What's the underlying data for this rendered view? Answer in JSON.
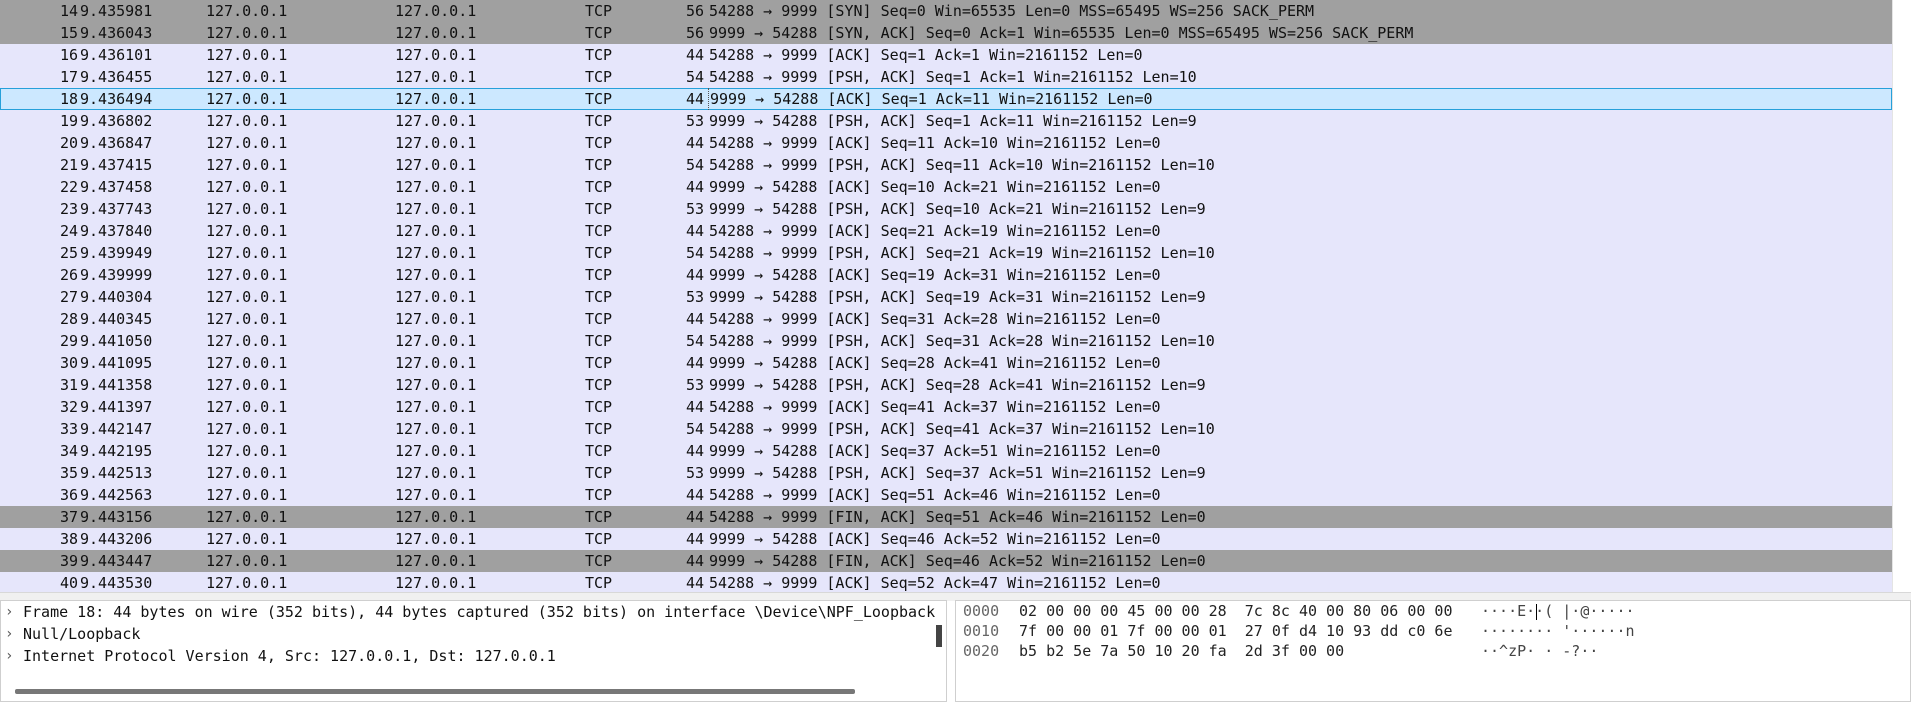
{
  "packets": [
    {
      "no": "14",
      "time": "9.435981",
      "src": "127.0.0.1",
      "dst": "127.0.0.1",
      "proto": "TCP",
      "len": "56",
      "info": "54288 → 9999 [SYN] Seq=0 Win=65535 Len=0 MSS=65495 WS=256 SACK_PERM",
      "style": "flag"
    },
    {
      "no": "15",
      "time": "9.436043",
      "src": "127.0.0.1",
      "dst": "127.0.0.1",
      "proto": "TCP",
      "len": "56",
      "info": "9999 → 54288 [SYN, ACK] Seq=0 Ack=1 Win=65535 Len=0 MSS=65495 WS=256 SACK_PERM",
      "style": "flag"
    },
    {
      "no": "16",
      "time": "9.436101",
      "src": "127.0.0.1",
      "dst": "127.0.0.1",
      "proto": "TCP",
      "len": "44",
      "info": "54288 → 9999 [ACK] Seq=1 Ack=1 Win=2161152 Len=0",
      "style": ""
    },
    {
      "no": "17",
      "time": "9.436455",
      "src": "127.0.0.1",
      "dst": "127.0.0.1",
      "proto": "TCP",
      "len": "54",
      "info": "54288 → 9999 [PSH, ACK] Seq=1 Ack=1 Win=2161152 Len=10",
      "style": ""
    },
    {
      "no": "18",
      "time": "9.436494",
      "src": "127.0.0.1",
      "dst": "127.0.0.1",
      "proto": "TCP",
      "len": "44",
      "info": "9999 → 54288 [ACK] Seq=1 Ack=11 Win=2161152 Len=0",
      "style": "sel"
    },
    {
      "no": "19",
      "time": "9.436802",
      "src": "127.0.0.1",
      "dst": "127.0.0.1",
      "proto": "TCP",
      "len": "53",
      "info": "9999 → 54288 [PSH, ACK] Seq=1 Ack=11 Win=2161152 Len=9",
      "style": ""
    },
    {
      "no": "20",
      "time": "9.436847",
      "src": "127.0.0.1",
      "dst": "127.0.0.1",
      "proto": "TCP",
      "len": "44",
      "info": "54288 → 9999 [ACK] Seq=11 Ack=10 Win=2161152 Len=0",
      "style": ""
    },
    {
      "no": "21",
      "time": "9.437415",
      "src": "127.0.0.1",
      "dst": "127.0.0.1",
      "proto": "TCP",
      "len": "54",
      "info": "54288 → 9999 [PSH, ACK] Seq=11 Ack=10 Win=2161152 Len=10",
      "style": ""
    },
    {
      "no": "22",
      "time": "9.437458",
      "src": "127.0.0.1",
      "dst": "127.0.0.1",
      "proto": "TCP",
      "len": "44",
      "info": "9999 → 54288 [ACK] Seq=10 Ack=21 Win=2161152 Len=0",
      "style": ""
    },
    {
      "no": "23",
      "time": "9.437743",
      "src": "127.0.0.1",
      "dst": "127.0.0.1",
      "proto": "TCP",
      "len": "53",
      "info": "9999 → 54288 [PSH, ACK] Seq=10 Ack=21 Win=2161152 Len=9",
      "style": ""
    },
    {
      "no": "24",
      "time": "9.437840",
      "src": "127.0.0.1",
      "dst": "127.0.0.1",
      "proto": "TCP",
      "len": "44",
      "info": "54288 → 9999 [ACK] Seq=21 Ack=19 Win=2161152 Len=0",
      "style": ""
    },
    {
      "no": "25",
      "time": "9.439949",
      "src": "127.0.0.1",
      "dst": "127.0.0.1",
      "proto": "TCP",
      "len": "54",
      "info": "54288 → 9999 [PSH, ACK] Seq=21 Ack=19 Win=2161152 Len=10",
      "style": ""
    },
    {
      "no": "26",
      "time": "9.439999",
      "src": "127.0.0.1",
      "dst": "127.0.0.1",
      "proto": "TCP",
      "len": "44",
      "info": "9999 → 54288 [ACK] Seq=19 Ack=31 Win=2161152 Len=0",
      "style": ""
    },
    {
      "no": "27",
      "time": "9.440304",
      "src": "127.0.0.1",
      "dst": "127.0.0.1",
      "proto": "TCP",
      "len": "53",
      "info": "9999 → 54288 [PSH, ACK] Seq=19 Ack=31 Win=2161152 Len=9",
      "style": ""
    },
    {
      "no": "28",
      "time": "9.440345",
      "src": "127.0.0.1",
      "dst": "127.0.0.1",
      "proto": "TCP",
      "len": "44",
      "info": "54288 → 9999 [ACK] Seq=31 Ack=28 Win=2161152 Len=0",
      "style": ""
    },
    {
      "no": "29",
      "time": "9.441050",
      "src": "127.0.0.1",
      "dst": "127.0.0.1",
      "proto": "TCP",
      "len": "54",
      "info": "54288 → 9999 [PSH, ACK] Seq=31 Ack=28 Win=2161152 Len=10",
      "style": ""
    },
    {
      "no": "30",
      "time": "9.441095",
      "src": "127.0.0.1",
      "dst": "127.0.0.1",
      "proto": "TCP",
      "len": "44",
      "info": "9999 → 54288 [ACK] Seq=28 Ack=41 Win=2161152 Len=0",
      "style": ""
    },
    {
      "no": "31",
      "time": "9.441358",
      "src": "127.0.0.1",
      "dst": "127.0.0.1",
      "proto": "TCP",
      "len": "53",
      "info": "9999 → 54288 [PSH, ACK] Seq=28 Ack=41 Win=2161152 Len=9",
      "style": ""
    },
    {
      "no": "32",
      "time": "9.441397",
      "src": "127.0.0.1",
      "dst": "127.0.0.1",
      "proto": "TCP",
      "len": "44",
      "info": "54288 → 9999 [ACK] Seq=41 Ack=37 Win=2161152 Len=0",
      "style": ""
    },
    {
      "no": "33",
      "time": "9.442147",
      "src": "127.0.0.1",
      "dst": "127.0.0.1",
      "proto": "TCP",
      "len": "54",
      "info": "54288 → 9999 [PSH, ACK] Seq=41 Ack=37 Win=2161152 Len=10",
      "style": ""
    },
    {
      "no": "34",
      "time": "9.442195",
      "src": "127.0.0.1",
      "dst": "127.0.0.1",
      "proto": "TCP",
      "len": "44",
      "info": "9999 → 54288 [ACK] Seq=37 Ack=51 Win=2161152 Len=0",
      "style": ""
    },
    {
      "no": "35",
      "time": "9.442513",
      "src": "127.0.0.1",
      "dst": "127.0.0.1",
      "proto": "TCP",
      "len": "53",
      "info": "9999 → 54288 [PSH, ACK] Seq=37 Ack=51 Win=2161152 Len=9",
      "style": ""
    },
    {
      "no": "36",
      "time": "9.442563",
      "src": "127.0.0.1",
      "dst": "127.0.0.1",
      "proto": "TCP",
      "len": "44",
      "info": "54288 → 9999 [ACK] Seq=51 Ack=46 Win=2161152 Len=0",
      "style": ""
    },
    {
      "no": "37",
      "time": "9.443156",
      "src": "127.0.0.1",
      "dst": "127.0.0.1",
      "proto": "TCP",
      "len": "44",
      "info": "54288 → 9999 [FIN, ACK] Seq=51 Ack=46 Win=2161152 Len=0",
      "style": "flag"
    },
    {
      "no": "38",
      "time": "9.443206",
      "src": "127.0.0.1",
      "dst": "127.0.0.1",
      "proto": "TCP",
      "len": "44",
      "info": "9999 → 54288 [ACK] Seq=46 Ack=52 Win=2161152 Len=0",
      "style": ""
    },
    {
      "no": "39",
      "time": "9.443447",
      "src": "127.0.0.1",
      "dst": "127.0.0.1",
      "proto": "TCP",
      "len": "44",
      "info": "9999 → 54288 [FIN, ACK] Seq=46 Ack=52 Win=2161152 Len=0",
      "style": "flag"
    },
    {
      "no": "40",
      "time": "9.443530",
      "src": "127.0.0.1",
      "dst": "127.0.0.1",
      "proto": "TCP",
      "len": "44",
      "info": "54288 → 9999 [ACK] Seq=52 Ack=47 Win=2161152 Len=0",
      "style": ""
    }
  ],
  "details": [
    {
      "arrow": "›",
      "text": "Frame 18: 44 bytes on wire (352 bits), 44 bytes captured (352 bits) on interface \\Device\\NPF_Loopback"
    },
    {
      "arrow": "›",
      "text": "Null/Loopback"
    },
    {
      "arrow": "›",
      "text": "Internet Protocol Version 4, Src: 127.0.0.1, Dst: 127.0.0.1"
    }
  ],
  "bytes": [
    {
      "offset": "0000",
      "hex": "02 00 00 00 45 00 00 28  7c 8c 40 00 80 06 00 00",
      "ascii": "····E··( |·@·····"
    },
    {
      "offset": "0010",
      "hex": "7f 00 00 01 7f 00 00 01  27 0f d4 10 93 dd c0 6e",
      "ascii": "········ '······n"
    },
    {
      "offset": "0020",
      "hex": "b5 b2 5e 7a 50 10 20 fa  2d 3f 00 00",
      "ascii": "··^zP· · -?··"
    }
  ],
  "colors": {
    "row_bg": "#e6e6fb",
    "flag_row_bg": "#a0a0a0",
    "selected_row_bg": "#cce8ff"
  }
}
